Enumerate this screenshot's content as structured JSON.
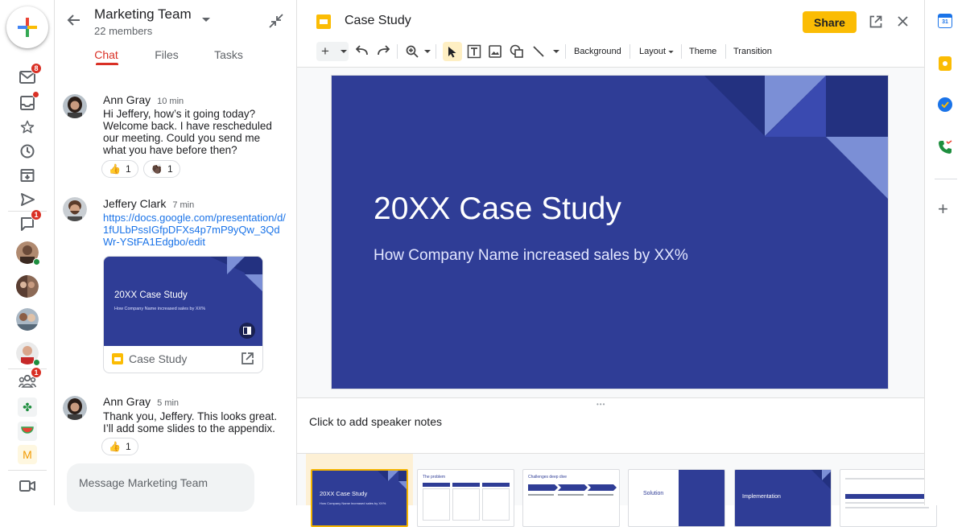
{
  "rail": {
    "mail_badge": "8",
    "chat_badge": "1",
    "spaces_badge": "1",
    "bottom_letter": "M"
  },
  "chat": {
    "title": "Marketing Team",
    "members": "22 members",
    "tabs": [
      "Chat",
      "Files",
      "Tasks"
    ],
    "messages": [
      {
        "sender": "Ann Gray",
        "time": "10 min",
        "text": "Hi Jeffery, how’s it going today? Welcome back. I have rescheduled our meeting. Could you send me what you have before then?",
        "reactions": [
          {
            "emoji": "👍",
            "count": "1"
          },
          {
            "emoji": "👏🏿",
            "count": "1"
          }
        ]
      },
      {
        "sender": "Jeffery Clark",
        "time": "7 min",
        "link": "https://docs.google.com/presentation/d/1fULbPssIGfpDFXs4p7mP9yQw_3QdWr-YStFA1Edgbo/edit",
        "card": {
          "slide_title": "20XX Case Study",
          "slide_subtitle": "How Company Name increased sales by XX%",
          "file_name": "Case Study"
        }
      },
      {
        "sender": "Ann Gray",
        "time": "5 min",
        "text": "Thank you, Jeffery. This looks great. I’ll add some slides to the appendix.",
        "reactions": [
          {
            "emoji": "👍",
            "count": "1"
          }
        ]
      }
    ],
    "composer_placeholder": "Message Marketing Team"
  },
  "editor": {
    "doc_title": "Case Study",
    "share_label": "Share",
    "toolbar": {
      "background": "Background",
      "layout": "Layout",
      "theme": "Theme",
      "transition": "Transition"
    },
    "slide": {
      "title": "20XX Case Study",
      "subtitle": "How Company Name increased sales by XX%"
    },
    "speaker_notes": "Click to add speaker notes",
    "thumbnails": [
      {
        "label": "20XX Case Study",
        "sub": "How Company Name increased sales by XX%"
      },
      {
        "label": "The problem"
      },
      {
        "label": "Challenges deep dive"
      },
      {
        "label": "Solution"
      },
      {
        "label": "Implementation"
      },
      {
        "label": ""
      }
    ]
  },
  "colors": {
    "slide_bg": "#2f3d96",
    "accent_red": "#d93025",
    "share_yellow": "#fbbc04",
    "link_blue": "#1a73e8"
  }
}
